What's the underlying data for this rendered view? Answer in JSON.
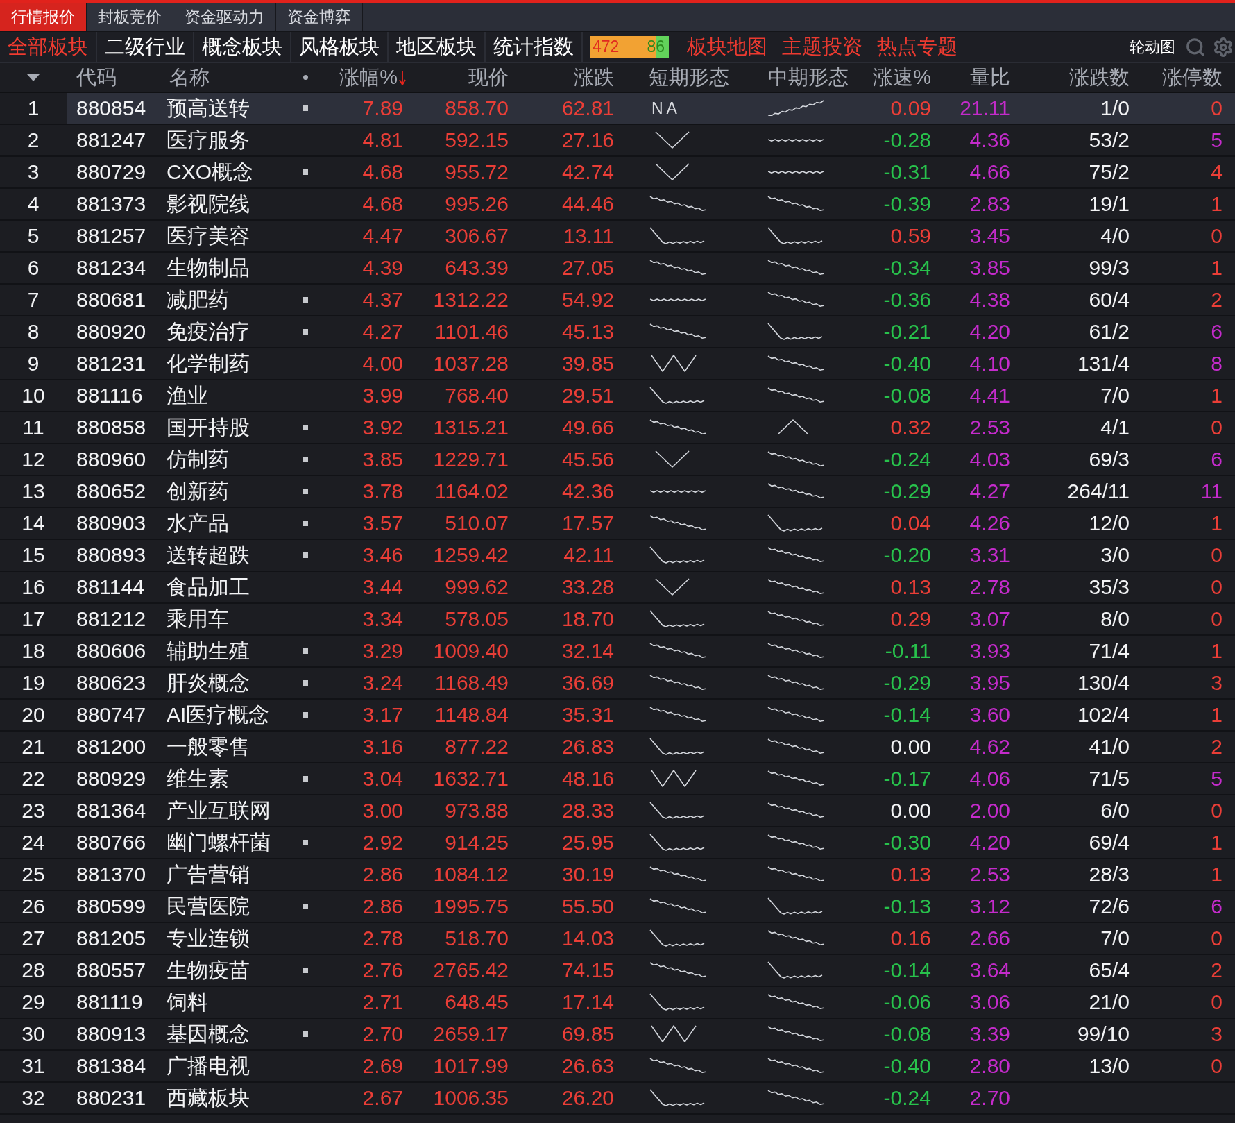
{
  "tabs": [
    {
      "label": "行情报价",
      "selected": true
    },
    {
      "label": "封板竞价",
      "selected": false
    },
    {
      "label": "资金驱动力",
      "selected": false
    },
    {
      "label": "资金博弈",
      "selected": false
    }
  ],
  "categories": [
    {
      "label": "全部板块",
      "selected": true
    },
    {
      "label": "二级行业",
      "selected": false
    },
    {
      "label": "概念板块",
      "selected": false
    },
    {
      "label": "风格板块",
      "selected": false
    },
    {
      "label": "地区板块",
      "selected": false
    },
    {
      "label": "统计指数",
      "selected": false
    }
  ],
  "breadth": {
    "up_count": "472",
    "down_count": "86",
    "level": 0.84
  },
  "links": [
    "板块地图",
    "主题投资",
    "热点专题"
  ],
  "rotation_button": "轮动图",
  "columns": [
    {
      "label": "代码",
      "sorted": false
    },
    {
      "label": "名称",
      "sorted": false
    },
    {
      "label": "涨幅%",
      "sorted": true
    },
    {
      "label": "现价",
      "sorted": false
    },
    {
      "label": "涨跌",
      "sorted": false
    },
    {
      "label": "短期形态",
      "sorted": false
    },
    {
      "label": "中期形态",
      "sorted": false
    },
    {
      "label": "涨速%",
      "sorted": false
    },
    {
      "label": "量比",
      "sorted": false
    },
    {
      "label": "涨跌数",
      "sorted": false
    },
    {
      "label": "涨停数",
      "sorted": false
    }
  ],
  "rows": [
    {
      "no": "1",
      "code": "880854",
      "name": "预高送转",
      "marked": true,
      "pct": "7.89",
      "price": "858.70",
      "change": "62.81",
      "short_shape": {
        "kind": "label",
        "text": "NA"
      },
      "mid_shape": {
        "kind": "rise"
      },
      "speed": {
        "text": "0.09",
        "color": "#ea3e37"
      },
      "vol_ratio": "21.11",
      "up_down": "1/0",
      "limit_up": {
        "text": "0",
        "color": "#ea3e37"
      },
      "selected": true
    },
    {
      "no": "2",
      "code": "881247",
      "name": "医疗服务",
      "marked": false,
      "pct": "4.81",
      "price": "592.15",
      "change": "27.16",
      "short_shape": {
        "kind": "v"
      },
      "mid_shape": {
        "kind": "flat"
      },
      "speed": {
        "text": "-0.28",
        "color": "#28c24c"
      },
      "vol_ratio": "4.36",
      "up_down": "53/2",
      "limit_up": {
        "text": "5",
        "color": "#c42bcb"
      },
      "selected": false
    },
    {
      "no": "3",
      "code": "880729",
      "name": "CXO概念",
      "marked": true,
      "pct": "4.68",
      "price": "955.72",
      "change": "42.74",
      "short_shape": {
        "kind": "v"
      },
      "mid_shape": {
        "kind": "flat"
      },
      "speed": {
        "text": "-0.31",
        "color": "#28c24c"
      },
      "vol_ratio": "4.66",
      "up_down": "75/2",
      "limit_up": {
        "text": "4",
        "color": "#ea3e37"
      },
      "selected": false
    },
    {
      "no": "4",
      "code": "881373",
      "name": "影视院线",
      "marked": false,
      "pct": "4.68",
      "price": "995.26",
      "change": "44.46",
      "short_shape": {
        "kind": "fall"
      },
      "mid_shape": {
        "kind": "fall"
      },
      "speed": {
        "text": "-0.39",
        "color": "#28c24c"
      },
      "vol_ratio": "2.83",
      "up_down": "19/1",
      "limit_up": {
        "text": "1",
        "color": "#ea3e37"
      },
      "selected": false
    },
    {
      "no": "5",
      "code": "881257",
      "name": "医疗美容",
      "marked": false,
      "pct": "4.47",
      "price": "306.67",
      "change": "13.11",
      "short_shape": {
        "kind": "drop"
      },
      "mid_shape": {
        "kind": "drop"
      },
      "speed": {
        "text": "0.59",
        "color": "#ea3e37"
      },
      "vol_ratio": "3.45",
      "up_down": "4/0",
      "limit_up": {
        "text": "0",
        "color": "#ea3e37"
      },
      "selected": false
    },
    {
      "no": "6",
      "code": "881234",
      "name": "生物制品",
      "marked": false,
      "pct": "4.39",
      "price": "643.39",
      "change": "27.05",
      "short_shape": {
        "kind": "fall"
      },
      "mid_shape": {
        "kind": "fall"
      },
      "speed": {
        "text": "-0.34",
        "color": "#28c24c"
      },
      "vol_ratio": "3.85",
      "up_down": "99/3",
      "limit_up": {
        "text": "1",
        "color": "#ea3e37"
      },
      "selected": false
    },
    {
      "no": "7",
      "code": "880681",
      "name": "减肥药",
      "marked": true,
      "pct": "4.37",
      "price": "1312.22",
      "change": "54.92",
      "short_shape": {
        "kind": "flat"
      },
      "mid_shape": {
        "kind": "fall"
      },
      "speed": {
        "text": "-0.36",
        "color": "#28c24c"
      },
      "vol_ratio": "4.38",
      "up_down": "60/4",
      "limit_up": {
        "text": "2",
        "color": "#ea3e37"
      },
      "selected": false
    },
    {
      "no": "8",
      "code": "880920",
      "name": "免疫治疗",
      "marked": true,
      "pct": "4.27",
      "price": "1101.46",
      "change": "45.13",
      "short_shape": {
        "kind": "fall"
      },
      "mid_shape": {
        "kind": "drop"
      },
      "speed": {
        "text": "-0.21",
        "color": "#28c24c"
      },
      "vol_ratio": "4.20",
      "up_down": "61/2",
      "limit_up": {
        "text": "6",
        "color": "#c42bcb"
      },
      "selected": false
    },
    {
      "no": "9",
      "code": "881231",
      "name": "化学制药",
      "marked": false,
      "pct": "4.00",
      "price": "1037.28",
      "change": "39.85",
      "short_shape": {
        "kind": "w"
      },
      "mid_shape": {
        "kind": "fall"
      },
      "speed": {
        "text": "-0.40",
        "color": "#28c24c"
      },
      "vol_ratio": "4.10",
      "up_down": "131/4",
      "limit_up": {
        "text": "8",
        "color": "#c42bcb"
      },
      "selected": false
    },
    {
      "no": "10",
      "code": "881116",
      "name": "渔业",
      "marked": false,
      "pct": "3.99",
      "price": "768.40",
      "change": "29.51",
      "short_shape": {
        "kind": "drop"
      },
      "mid_shape": {
        "kind": "fall"
      },
      "speed": {
        "text": "-0.08",
        "color": "#28c24c"
      },
      "vol_ratio": "4.41",
      "up_down": "7/0",
      "limit_up": {
        "text": "1",
        "color": "#ea3e37"
      },
      "selected": false
    },
    {
      "no": "11",
      "code": "880858",
      "name": "国开持股",
      "marked": true,
      "pct": "3.92",
      "price": "1315.21",
      "change": "49.66",
      "short_shape": {
        "kind": "fall"
      },
      "mid_shape": {
        "kind": "peak"
      },
      "speed": {
        "text": "0.32",
        "color": "#ea3e37"
      },
      "vol_ratio": "2.53",
      "up_down": "4/1",
      "limit_up": {
        "text": "0",
        "color": "#ea3e37"
      },
      "selected": false
    },
    {
      "no": "12",
      "code": "880960",
      "name": "仿制药",
      "marked": true,
      "pct": "3.85",
      "price": "1229.71",
      "change": "45.56",
      "short_shape": {
        "kind": "v"
      },
      "mid_shape": {
        "kind": "fall"
      },
      "speed": {
        "text": "-0.24",
        "color": "#28c24c"
      },
      "vol_ratio": "4.03",
      "up_down": "69/3",
      "limit_up": {
        "text": "6",
        "color": "#c42bcb"
      },
      "selected": false
    },
    {
      "no": "13",
      "code": "880652",
      "name": "创新药",
      "marked": true,
      "pct": "3.78",
      "price": "1164.02",
      "change": "42.36",
      "short_shape": {
        "kind": "flat"
      },
      "mid_shape": {
        "kind": "fall"
      },
      "speed": {
        "text": "-0.29",
        "color": "#28c24c"
      },
      "vol_ratio": "4.27",
      "up_down": "264/11",
      "limit_up": {
        "text": "11",
        "color": "#c42bcb"
      },
      "selected": false
    },
    {
      "no": "14",
      "code": "880903",
      "name": "水产品",
      "marked": true,
      "pct": "3.57",
      "price": "510.07",
      "change": "17.57",
      "short_shape": {
        "kind": "fall"
      },
      "mid_shape": {
        "kind": "drop"
      },
      "speed": {
        "text": "0.04",
        "color": "#ea3e37"
      },
      "vol_ratio": "4.26",
      "up_down": "12/0",
      "limit_up": {
        "text": "1",
        "color": "#ea3e37"
      },
      "selected": false
    },
    {
      "no": "15",
      "code": "880893",
      "name": "送转超跌",
      "marked": true,
      "pct": "3.46",
      "price": "1259.42",
      "change": "42.11",
      "short_shape": {
        "kind": "drop"
      },
      "mid_shape": {
        "kind": "fall"
      },
      "speed": {
        "text": "-0.20",
        "color": "#28c24c"
      },
      "vol_ratio": "3.31",
      "up_down": "3/0",
      "limit_up": {
        "text": "0",
        "color": "#ea3e37"
      },
      "selected": false
    },
    {
      "no": "16",
      "code": "881144",
      "name": "食品加工",
      "marked": false,
      "pct": "3.44",
      "price": "999.62",
      "change": "33.28",
      "short_shape": {
        "kind": "v"
      },
      "mid_shape": {
        "kind": "fall"
      },
      "speed": {
        "text": "0.13",
        "color": "#ea3e37"
      },
      "vol_ratio": "2.78",
      "up_down": "35/3",
      "limit_up": {
        "text": "0",
        "color": "#ea3e37"
      },
      "selected": false
    },
    {
      "no": "17",
      "code": "881212",
      "name": "乘用车",
      "marked": false,
      "pct": "3.34",
      "price": "578.05",
      "change": "18.70",
      "short_shape": {
        "kind": "drop"
      },
      "mid_shape": {
        "kind": "fall"
      },
      "speed": {
        "text": "0.29",
        "color": "#ea3e37"
      },
      "vol_ratio": "3.07",
      "up_down": "8/0",
      "limit_up": {
        "text": "0",
        "color": "#ea3e37"
      },
      "selected": false
    },
    {
      "no": "18",
      "code": "880606",
      "name": "辅助生殖",
      "marked": true,
      "pct": "3.29",
      "price": "1009.40",
      "change": "32.14",
      "short_shape": {
        "kind": "fall"
      },
      "mid_shape": {
        "kind": "fall"
      },
      "speed": {
        "text": "-0.11",
        "color": "#28c24c"
      },
      "vol_ratio": "3.93",
      "up_down": "71/4",
      "limit_up": {
        "text": "1",
        "color": "#ea3e37"
      },
      "selected": false
    },
    {
      "no": "19",
      "code": "880623",
      "name": "肝炎概念",
      "marked": true,
      "pct": "3.24",
      "price": "1168.49",
      "change": "36.69",
      "short_shape": {
        "kind": "fall"
      },
      "mid_shape": {
        "kind": "fall"
      },
      "speed": {
        "text": "-0.29",
        "color": "#28c24c"
      },
      "vol_ratio": "3.95",
      "up_down": "130/4",
      "limit_up": {
        "text": "3",
        "color": "#ea3e37"
      },
      "selected": false
    },
    {
      "no": "20",
      "code": "880747",
      "name": "AI医疗概念",
      "marked": true,
      "pct": "3.17",
      "price": "1148.84",
      "change": "35.31",
      "short_shape": {
        "kind": "fall"
      },
      "mid_shape": {
        "kind": "fall"
      },
      "speed": {
        "text": "-0.14",
        "color": "#28c24c"
      },
      "vol_ratio": "3.60",
      "up_down": "102/4",
      "limit_up": {
        "text": "1",
        "color": "#ea3e37"
      },
      "selected": false
    },
    {
      "no": "21",
      "code": "881200",
      "name": "一般零售",
      "marked": false,
      "pct": "3.16",
      "price": "877.22",
      "change": "26.83",
      "short_shape": {
        "kind": "drop"
      },
      "mid_shape": {
        "kind": "fall"
      },
      "speed": {
        "text": "0.00",
        "color": "#f2f3f5"
      },
      "vol_ratio": "4.62",
      "up_down": "41/0",
      "limit_up": {
        "text": "2",
        "color": "#ea3e37"
      },
      "selected": false
    },
    {
      "no": "22",
      "code": "880929",
      "name": "维生素",
      "marked": true,
      "pct": "3.04",
      "price": "1632.71",
      "change": "48.16",
      "short_shape": {
        "kind": "w"
      },
      "mid_shape": {
        "kind": "fall"
      },
      "speed": {
        "text": "-0.17",
        "color": "#28c24c"
      },
      "vol_ratio": "4.06",
      "up_down": "71/5",
      "limit_up": {
        "text": "5",
        "color": "#c42bcb"
      },
      "selected": false
    },
    {
      "no": "23",
      "code": "881364",
      "name": "产业互联网",
      "marked": false,
      "pct": "3.00",
      "price": "973.88",
      "change": "28.33",
      "short_shape": {
        "kind": "drop"
      },
      "mid_shape": {
        "kind": "fall"
      },
      "speed": {
        "text": "0.00",
        "color": "#f2f3f5"
      },
      "vol_ratio": "2.00",
      "up_down": "6/0",
      "limit_up": {
        "text": "0",
        "color": "#ea3e37"
      },
      "selected": false
    },
    {
      "no": "24",
      "code": "880766",
      "name": "幽门螺杆菌",
      "marked": true,
      "pct": "2.92",
      "price": "914.25",
      "change": "25.95",
      "short_shape": {
        "kind": "drop"
      },
      "mid_shape": {
        "kind": "fall"
      },
      "speed": {
        "text": "-0.30",
        "color": "#28c24c"
      },
      "vol_ratio": "4.20",
      "up_down": "69/4",
      "limit_up": {
        "text": "1",
        "color": "#ea3e37"
      },
      "selected": false
    },
    {
      "no": "25",
      "code": "881370",
      "name": "广告营销",
      "marked": false,
      "pct": "2.86",
      "price": "1084.12",
      "change": "30.19",
      "short_shape": {
        "kind": "fall"
      },
      "mid_shape": {
        "kind": "fall"
      },
      "speed": {
        "text": "0.13",
        "color": "#ea3e37"
      },
      "vol_ratio": "2.53",
      "up_down": "28/3",
      "limit_up": {
        "text": "1",
        "color": "#ea3e37"
      },
      "selected": false
    },
    {
      "no": "26",
      "code": "880599",
      "name": "民营医院",
      "marked": true,
      "pct": "2.86",
      "price": "1995.75",
      "change": "55.50",
      "short_shape": {
        "kind": "fall"
      },
      "mid_shape": {
        "kind": "drop"
      },
      "speed": {
        "text": "-0.13",
        "color": "#28c24c"
      },
      "vol_ratio": "3.12",
      "up_down": "72/6",
      "limit_up": {
        "text": "6",
        "color": "#c42bcb"
      },
      "selected": false
    },
    {
      "no": "27",
      "code": "881205",
      "name": "专业连锁",
      "marked": false,
      "pct": "2.78",
      "price": "518.70",
      "change": "14.03",
      "short_shape": {
        "kind": "drop"
      },
      "mid_shape": {
        "kind": "fall"
      },
      "speed": {
        "text": "0.16",
        "color": "#ea3e37"
      },
      "vol_ratio": "2.66",
      "up_down": "7/0",
      "limit_up": {
        "text": "0",
        "color": "#ea3e37"
      },
      "selected": false
    },
    {
      "no": "28",
      "code": "880557",
      "name": "生物疫苗",
      "marked": true,
      "pct": "2.76",
      "price": "2765.42",
      "change": "74.15",
      "short_shape": {
        "kind": "fall"
      },
      "mid_shape": {
        "kind": "drop"
      },
      "speed": {
        "text": "-0.14",
        "color": "#28c24c"
      },
      "vol_ratio": "3.64",
      "up_down": "65/4",
      "limit_up": {
        "text": "2",
        "color": "#ea3e37"
      },
      "selected": false
    },
    {
      "no": "29",
      "code": "881119",
      "name": "饲料",
      "marked": false,
      "pct": "2.71",
      "price": "648.45",
      "change": "17.14",
      "short_shape": {
        "kind": "drop"
      },
      "mid_shape": {
        "kind": "fall"
      },
      "speed": {
        "text": "-0.06",
        "color": "#28c24c"
      },
      "vol_ratio": "3.06",
      "up_down": "21/0",
      "limit_up": {
        "text": "0",
        "color": "#ea3e37"
      },
      "selected": false
    },
    {
      "no": "30",
      "code": "880913",
      "name": "基因概念",
      "marked": true,
      "pct": "2.70",
      "price": "2659.17",
      "change": "69.85",
      "short_shape": {
        "kind": "w"
      },
      "mid_shape": {
        "kind": "fall"
      },
      "speed": {
        "text": "-0.08",
        "color": "#28c24c"
      },
      "vol_ratio": "3.39",
      "up_down": "99/10",
      "limit_up": {
        "text": "3",
        "color": "#ea3e37"
      },
      "selected": false
    },
    {
      "no": "31",
      "code": "881384",
      "name": "广播电视",
      "marked": false,
      "pct": "2.69",
      "price": "1017.99",
      "change": "26.63",
      "short_shape": {
        "kind": "fall"
      },
      "mid_shape": {
        "kind": "fall"
      },
      "speed": {
        "text": "-0.40",
        "color": "#28c24c"
      },
      "vol_ratio": "2.80",
      "up_down": "13/0",
      "limit_up": {
        "text": "0",
        "color": "#ea3e37"
      },
      "selected": false
    },
    {
      "no": "32",
      "code": "880231",
      "name": "西藏板块",
      "marked": false,
      "pct": "2.67",
      "price": "1006.35",
      "change": "26.20",
      "short_shape": {
        "kind": "drop"
      },
      "mid_shape": {
        "kind": "fall"
      },
      "speed": {
        "text": "-0.24",
        "color": "#28c24c"
      },
      "vol_ratio": "2.70",
      "selected": false
    }
  ]
}
